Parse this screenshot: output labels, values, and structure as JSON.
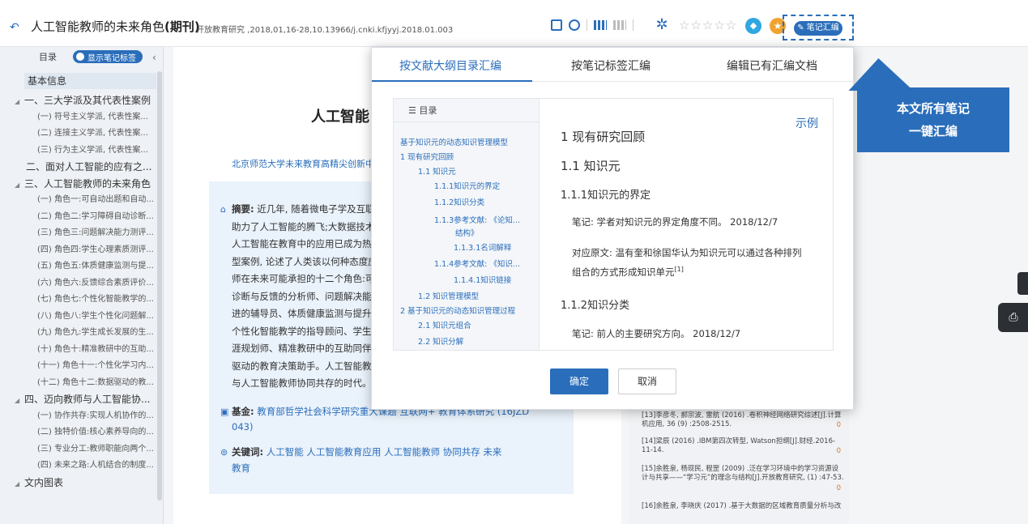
{
  "doc": {
    "title": "人工智能教师的未来角色",
    "type_label": "(期刊)",
    "source": "开放教育研究 ,2018,01,16-28,10.13966/j.cnki.kfjyyj.2018.01.003",
    "note_button": "笔记汇编",
    "stars": "☆☆☆☆☆"
  },
  "sidebar": {
    "toc_label": "目录",
    "toggle_label": "显示笔记标签",
    "basic_info": "基本信息",
    "items": [
      {
        "level": "l1",
        "text": "一、三大学派及其代表性案例",
        "caret": true
      },
      {
        "level": "l2",
        "text": "(一) 符号主义学派, 代表性案..."
      },
      {
        "level": "l2",
        "text": "(二) 连接主义学派, 代表性案..."
      },
      {
        "level": "l2",
        "text": "(三) 行为主义学派, 代表性案..."
      },
      {
        "level": "l1b",
        "text": "二、面对人工智能的应有之..."
      },
      {
        "level": "l1",
        "text": "三、人工智能教师的未来角色",
        "caret": true
      },
      {
        "level": "l2",
        "text": "(一) 角色一:可自动出题和自动..."
      },
      {
        "level": "l2",
        "text": "(二) 角色二:学习障碍自动诊断..."
      },
      {
        "level": "l2",
        "text": "(三) 角色三:问题解决能力测评..."
      },
      {
        "level": "l2",
        "text": "(四) 角色四:学生心理素质测评..."
      },
      {
        "level": "l2",
        "text": "(五) 角色五:体质健康监测与提..."
      },
      {
        "level": "l2",
        "text": "(六) 角色六:反馈综合素质评价..."
      },
      {
        "level": "l2",
        "text": "(七) 角色七:个性化智能教学的..."
      },
      {
        "level": "l2",
        "text": "(八) 角色八:学生个性化问题解..."
      },
      {
        "level": "l2",
        "text": "(九) 角色九:学生成长发展的生..."
      },
      {
        "level": "l2",
        "text": "(十) 角色十:精准教研中的互助..."
      },
      {
        "level": "l2",
        "text": "(十一) 角色十一:个性化学习内..."
      },
      {
        "level": "l2",
        "text": "(十二) 角色十二:数据驱动的教..."
      },
      {
        "level": "l1",
        "text": "四、迈向教师与人工智能协...",
        "caret": true
      },
      {
        "level": "l2",
        "text": "(一) 协作共存:实现人机协作的..."
      },
      {
        "level": "l2",
        "text": "(二) 独特价值:核心素养导向的..."
      },
      {
        "level": "l2",
        "text": "(三) 专业分工:教师职能向两个..."
      },
      {
        "level": "l2",
        "text": "(四) 未来之路:人机结合的制度..."
      },
      {
        "level": "l1",
        "text": "文内图表",
        "caret": true
      }
    ]
  },
  "main": {
    "title": "人工智能",
    "affiliation": "北京师范大学未来教育高精尖创新中",
    "abstract_label": "摘要:",
    "abstract_lines": [
      "近几年, 随着微电子学及互联",
      "助力了人工智能的腾飞;大数据技术",
      "人工智能在教育中的应用已成为热议",
      "型案例, 论述了人类该以何种态度应",
      "师在未来可能承担的十二个角色:可",
      "诊断与反馈的分析师、问题解决能力",
      "进的辅导员、体质健康监测与提升的",
      "个性化智能教学的指导顾问、学生",
      "涯规划师、精准教研中的互助同伴、",
      "驱动的教育决策助手。人工智能教师",
      "与人工智能教师协同共存的时代。"
    ],
    "fund_label": "基金:",
    "fund_text": "教育部哲学社会科学研究重大课题   互联网+ 教育体系研究 (16JZD",
    "fund_text2": "043)",
    "keywords_label": "关键词:",
    "keywords": "人工智能  人工智能教育应用  人工智能教师  协同共存  未来",
    "keywords2": "教育"
  },
  "refs": [
    {
      "text": "[13]李彦冬, 郝宗波, 雷航 (2016) .卷积神经网络研究综述[J].计算机应用, 36 (9) :2508-2515.",
      "count": "0"
    },
    {
      "text": "[14]梁辰 (2016) .IBM第四次转型, Watson担纲[J].财经.2016-11-14.",
      "count": "0"
    },
    {
      "text": "[15]余胜泉, 杨现民, 程罡 (2009) .泛在学习环境中的学习资源设计与共享——“学习元”的理念与结构[J].开放教育研究, (1) :47-53.",
      "count": "0"
    },
    {
      "text": "[16]余胜泉, 李晓庆 (2017) .基于大数据的区域教育质量分析与改",
      "count": ""
    }
  ],
  "modal": {
    "tabs": [
      "按文献大纲目录汇编",
      "按笔记标签汇编",
      "编辑已有汇编文档"
    ],
    "toc_head": "☰ 目录",
    "toc_items": [
      "基于知识元的动态知识管理模型",
      "1 现有研究回顾",
      "1.1 知识元",
      "1.1.1知识元的界定",
      "1.1.2知识分类",
      "1.1.3参考文献: 《论知...",
      "结构》",
      "1.1.3.1名词解释",
      "1.1.4参考文献: 《知识...",
      "1.1.4.1知识链接",
      "1.2 知识管理模型",
      "2 基于知识元的动态知识管理过程",
      "2.1 知识元组合",
      "2.2 知识分解"
    ],
    "example": "示例",
    "content": {
      "h1": "1 现有研究回顾",
      "h2": "1.1 知识元",
      "h3": "1.1.1知识元的界定",
      "note1": "笔记: 学者对知识元的界定角度不同。 2018/12/7",
      "orig1": "对应原文: 温有奎和徐国华认为知识元可以通过各种排列",
      "orig2": "组合的方式形成知识单元",
      "sup": "[1]",
      "h3b": "1.1.2知识分类",
      "note2": "笔记: 前人的主要研究方向。 2018/12/7"
    },
    "ok": "确定",
    "cancel": "取消"
  },
  "callout": {
    "line1": "本文所有笔记",
    "line2": "一键汇编"
  }
}
